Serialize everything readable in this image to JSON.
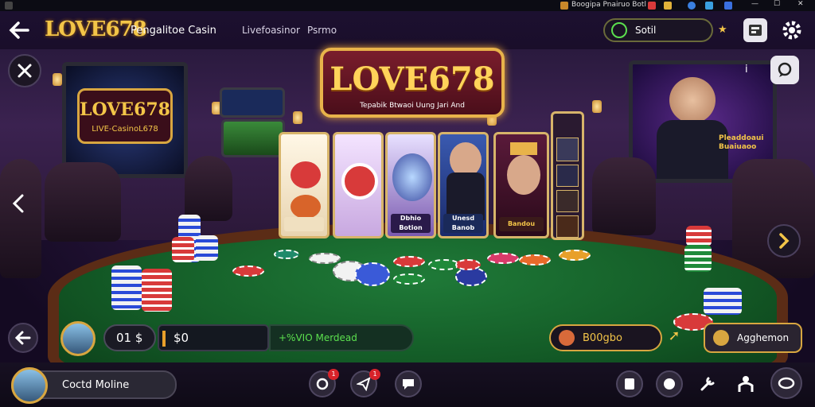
{
  "sysbar": {
    "left_title": "",
    "tab_a": "",
    "tab_b": "",
    "right_title": "Boogipa Pnairuo Botl"
  },
  "header": {
    "logo": "LOVE678",
    "subtitle": "Pengalitoe Casin",
    "nav": [
      "Livefoasinor",
      "Psrmo"
    ],
    "search_value": "Sotil"
  },
  "sign": {
    "title": "LOVE678",
    "subtitle": "Tepabik Btwaoi Uung Jari And"
  },
  "left_screen": {
    "title": "LOVE678",
    "sub": "LIVE-CasinoL678"
  },
  "cards": [
    {
      "caption": ""
    },
    {
      "caption": ""
    },
    {
      "caption": "Dbhio Botion"
    },
    {
      "caption": "Unesd Banob"
    },
    {
      "caption": "Bandou"
    }
  ],
  "right_screen": {
    "caption": "Pleaddoaui Buaiuaoo"
  },
  "bottom_bar": {
    "balance": "01 $",
    "bet": "$0",
    "vip": "+%VIO Merdead",
    "right_pill": "B00gbo",
    "right_pill2": "Agghemon"
  },
  "footer": {
    "user_label": "Coctd Moline",
    "badge_count_1": "1",
    "badge_count_2": "1"
  },
  "colors": {
    "gold": "#f3c548",
    "felt": "#135a26",
    "accent_green": "#5be04e",
    "badge_red": "#d8232a"
  }
}
